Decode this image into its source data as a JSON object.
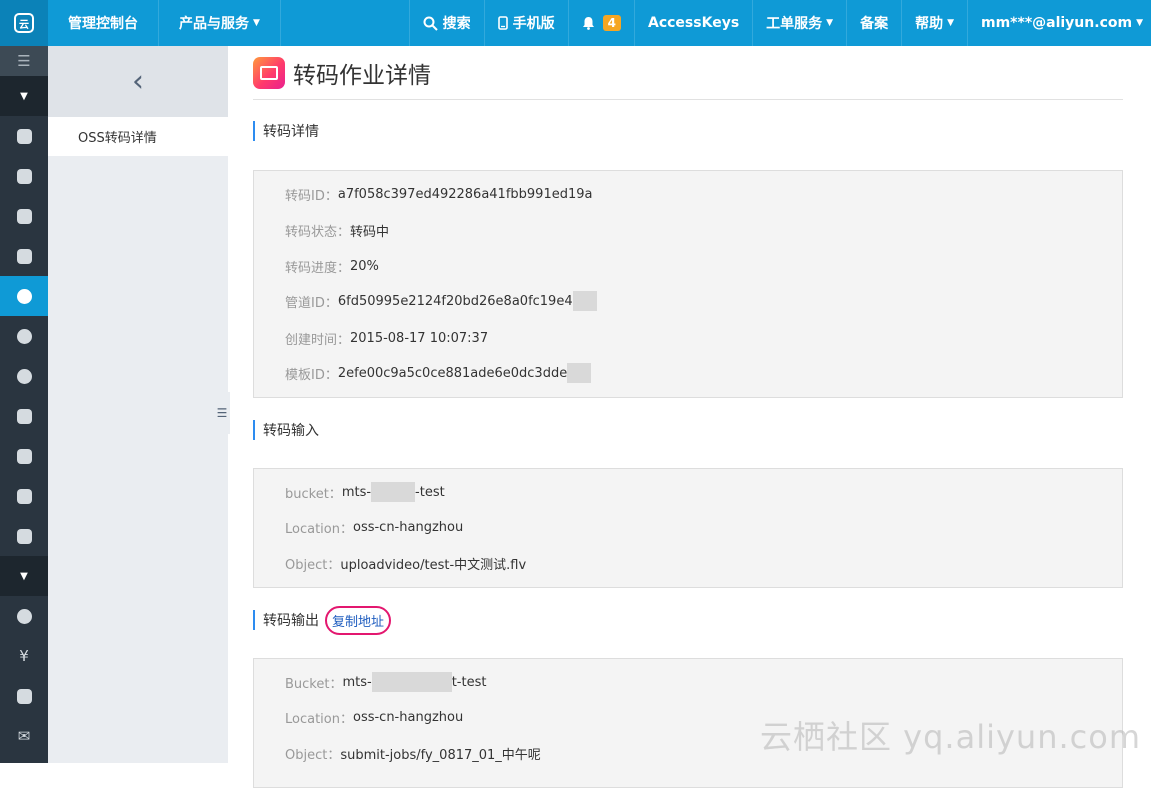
{
  "topbar": {
    "console": "管理控制台",
    "products": "产品与服务",
    "search": "搜索",
    "mobile": "手机版",
    "notifications_count": "4",
    "access_keys": "AccessKeys",
    "tickets": "工单服务",
    "beian": "备案",
    "help": "帮助",
    "user": "mm***@aliyun.com"
  },
  "sidebar": {
    "nav_item": "OSS转码详情"
  },
  "page": {
    "title": "转码作业详情"
  },
  "details": {
    "title": "转码详情",
    "rows": [
      {
        "label": "转码ID：",
        "value": "a7f058c397ed492286a41fbb991ed19a"
      },
      {
        "label": "转码状态：",
        "value": "转码中"
      },
      {
        "label": "转码进度：",
        "value": "20%"
      },
      {
        "label": "管道ID：",
        "value": "6fd50995e2124f20bd26e8a0fc19e4"
      },
      {
        "label": "创建时间：",
        "value": "2015-08-17 10:07:37"
      },
      {
        "label": "模板ID：",
        "value": "2efe00c9a5c0ce881ade6e0dc3dde"
      }
    ]
  },
  "input": {
    "title": "转码输入",
    "bucket_label": "bucket：",
    "bucket_prefix": "mts-",
    "bucket_suffix": "-test",
    "location_label": "Location：",
    "location_value": "oss-cn-hangzhou",
    "object_label": "Object：",
    "object_value": "uploadvideo/test-中文测试.flv"
  },
  "output": {
    "title": "转码输出",
    "copy_link": "复制地址",
    "bucket_label": "Bucket：",
    "bucket_prefix": "mts-",
    "bucket_suffix": "t-test",
    "location_label": "Location：",
    "location_value": "oss-cn-hangzhou",
    "object_label": "Object：",
    "object_value": "submit-jobs/fy_0817_01_中午呢"
  },
  "watermark": "云栖社区 yq.aliyun.com"
}
